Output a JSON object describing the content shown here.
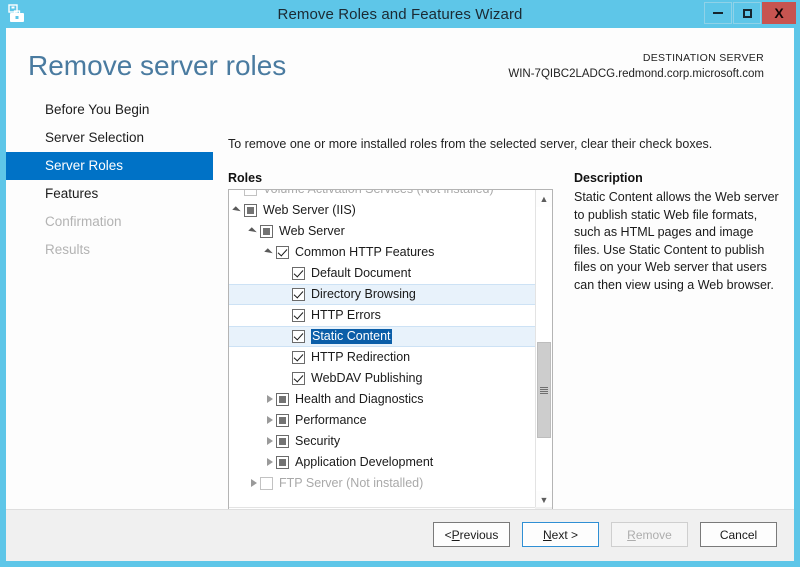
{
  "window": {
    "title": "Remove Roles and Features Wizard",
    "icon": "server-toolbox-icon",
    "minimize_label": "Minimize",
    "maximize_label": "Maximize",
    "close_label": "X",
    "titlebar_color": "#5ec6e8"
  },
  "header": {
    "page_title": "Remove server roles",
    "destination_label": "DESTINATION SERVER",
    "destination_server": "WIN-7QIBC2LADCG.redmond.corp.microsoft.com",
    "title_color": "#4a7ba0"
  },
  "sidebar": {
    "items": [
      {
        "label": "Before You Begin",
        "state": "normal"
      },
      {
        "label": "Server Selection",
        "state": "normal"
      },
      {
        "label": "Server Roles",
        "state": "selected"
      },
      {
        "label": "Features",
        "state": "normal"
      },
      {
        "label": "Confirmation",
        "state": "disabled"
      },
      {
        "label": "Results",
        "state": "disabled"
      }
    ],
    "selected_color": "#0072c6"
  },
  "main": {
    "instruction": "To remove one or more installed roles from the selected server, clear their check boxes.",
    "roles_header": "Roles",
    "description_header": "Description",
    "description_text": "Static Content allows the Web server to publish static Web file formats, such as HTML pages and image files. Use Static Content to publish files on your Web server that users can then view using a Web browser."
  },
  "tree": {
    "rows": [
      {
        "label": "Volume Activation Services (Not installed)",
        "indent": 0,
        "twisty": "none",
        "checkbox": "unchecked",
        "dim": true,
        "row_state": "clipped"
      },
      {
        "label": "Web Server (IIS)",
        "indent": 0,
        "twisty": "expanded",
        "checkbox": "partial",
        "dim": false,
        "row_state": "normal"
      },
      {
        "label": "Web Server",
        "indent": 1,
        "twisty": "expanded",
        "checkbox": "partial",
        "dim": false,
        "row_state": "normal"
      },
      {
        "label": "Common HTTP Features",
        "indent": 2,
        "twisty": "expanded",
        "checkbox": "checked",
        "dim": false,
        "row_state": "normal"
      },
      {
        "label": "Default Document",
        "indent": 3,
        "twisty": "none",
        "checkbox": "checked",
        "dim": false,
        "row_state": "normal"
      },
      {
        "label": "Directory Browsing",
        "indent": 3,
        "twisty": "none",
        "checkbox": "checked",
        "dim": false,
        "row_state": "hover"
      },
      {
        "label": "HTTP Errors",
        "indent": 3,
        "twisty": "none",
        "checkbox": "checked",
        "dim": false,
        "row_state": "normal"
      },
      {
        "label": "Static Content",
        "indent": 3,
        "twisty": "none",
        "checkbox": "checked",
        "dim": false,
        "row_state": "selected"
      },
      {
        "label": "HTTP Redirection",
        "indent": 3,
        "twisty": "none",
        "checkbox": "checked",
        "dim": false,
        "row_state": "normal"
      },
      {
        "label": "WebDAV Publishing",
        "indent": 3,
        "twisty": "none",
        "checkbox": "checked",
        "dim": false,
        "row_state": "normal"
      },
      {
        "label": "Health and Diagnostics",
        "indent": 2,
        "twisty": "collapsed",
        "checkbox": "partial",
        "dim": false,
        "row_state": "normal"
      },
      {
        "label": "Performance",
        "indent": 2,
        "twisty": "collapsed",
        "checkbox": "partial",
        "dim": false,
        "row_state": "normal"
      },
      {
        "label": "Security",
        "indent": 2,
        "twisty": "collapsed",
        "checkbox": "partial",
        "dim": false,
        "row_state": "normal"
      },
      {
        "label": "Application Development",
        "indent": 2,
        "twisty": "collapsed",
        "checkbox": "partial",
        "dim": false,
        "row_state": "normal"
      },
      {
        "label": "FTP Server (Not installed)",
        "indent": 1,
        "twisty": "collapsed",
        "checkbox": "unchecked",
        "dim": true,
        "row_state": "normal"
      }
    ],
    "selection_color": "#0b5ea8",
    "hover_color": "#e8f2fb",
    "scroll_up_icon": "chevron-up-icon",
    "scroll_down_icon": "chevron-down-icon",
    "scroll_left_icon": "chevron-left-icon",
    "scroll_right_icon": "chevron-right-icon"
  },
  "footer": {
    "buttons": [
      {
        "label": "< Previous",
        "accel": "P",
        "state": "normal"
      },
      {
        "label": "Next >",
        "accel": "N",
        "state": "focused"
      },
      {
        "label": "Remove",
        "accel": "R",
        "state": "disabled"
      },
      {
        "label": "Cancel",
        "accel": "",
        "state": "normal"
      }
    ]
  }
}
